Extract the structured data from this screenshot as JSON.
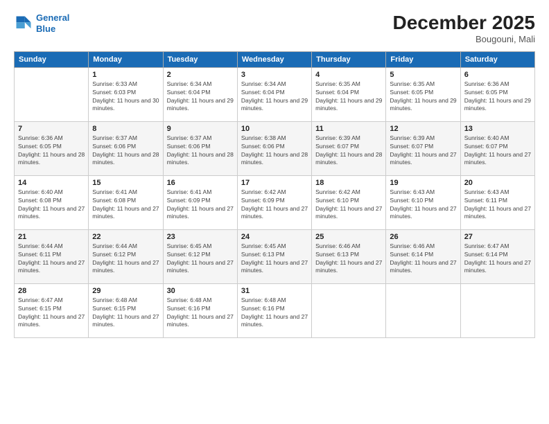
{
  "logo": {
    "line1": "General",
    "line2": "Blue"
  },
  "header": {
    "month": "December 2025",
    "location": "Bougouni, Mali"
  },
  "days_of_week": [
    "Sunday",
    "Monday",
    "Tuesday",
    "Wednesday",
    "Thursday",
    "Friday",
    "Saturday"
  ],
  "weeks": [
    [
      {
        "day": "",
        "sunrise": "",
        "sunset": "",
        "daylight": ""
      },
      {
        "day": "1",
        "sunrise": "Sunrise: 6:33 AM",
        "sunset": "Sunset: 6:03 PM",
        "daylight": "Daylight: 11 hours and 30 minutes."
      },
      {
        "day": "2",
        "sunrise": "Sunrise: 6:34 AM",
        "sunset": "Sunset: 6:04 PM",
        "daylight": "Daylight: 11 hours and 29 minutes."
      },
      {
        "day": "3",
        "sunrise": "Sunrise: 6:34 AM",
        "sunset": "Sunset: 6:04 PM",
        "daylight": "Daylight: 11 hours and 29 minutes."
      },
      {
        "day": "4",
        "sunrise": "Sunrise: 6:35 AM",
        "sunset": "Sunset: 6:04 PM",
        "daylight": "Daylight: 11 hours and 29 minutes."
      },
      {
        "day": "5",
        "sunrise": "Sunrise: 6:35 AM",
        "sunset": "Sunset: 6:05 PM",
        "daylight": "Daylight: 11 hours and 29 minutes."
      },
      {
        "day": "6",
        "sunrise": "Sunrise: 6:36 AM",
        "sunset": "Sunset: 6:05 PM",
        "daylight": "Daylight: 11 hours and 29 minutes."
      }
    ],
    [
      {
        "day": "7",
        "sunrise": "Sunrise: 6:36 AM",
        "sunset": "Sunset: 6:05 PM",
        "daylight": "Daylight: 11 hours and 28 minutes."
      },
      {
        "day": "8",
        "sunrise": "Sunrise: 6:37 AM",
        "sunset": "Sunset: 6:06 PM",
        "daylight": "Daylight: 11 hours and 28 minutes."
      },
      {
        "day": "9",
        "sunrise": "Sunrise: 6:37 AM",
        "sunset": "Sunset: 6:06 PM",
        "daylight": "Daylight: 11 hours and 28 minutes."
      },
      {
        "day": "10",
        "sunrise": "Sunrise: 6:38 AM",
        "sunset": "Sunset: 6:06 PM",
        "daylight": "Daylight: 11 hours and 28 minutes."
      },
      {
        "day": "11",
        "sunrise": "Sunrise: 6:39 AM",
        "sunset": "Sunset: 6:07 PM",
        "daylight": "Daylight: 11 hours and 28 minutes."
      },
      {
        "day": "12",
        "sunrise": "Sunrise: 6:39 AM",
        "sunset": "Sunset: 6:07 PM",
        "daylight": "Daylight: 11 hours and 27 minutes."
      },
      {
        "day": "13",
        "sunrise": "Sunrise: 6:40 AM",
        "sunset": "Sunset: 6:07 PM",
        "daylight": "Daylight: 11 hours and 27 minutes."
      }
    ],
    [
      {
        "day": "14",
        "sunrise": "Sunrise: 6:40 AM",
        "sunset": "Sunset: 6:08 PM",
        "daylight": "Daylight: 11 hours and 27 minutes."
      },
      {
        "day": "15",
        "sunrise": "Sunrise: 6:41 AM",
        "sunset": "Sunset: 6:08 PM",
        "daylight": "Daylight: 11 hours and 27 minutes."
      },
      {
        "day": "16",
        "sunrise": "Sunrise: 6:41 AM",
        "sunset": "Sunset: 6:09 PM",
        "daylight": "Daylight: 11 hours and 27 minutes."
      },
      {
        "day": "17",
        "sunrise": "Sunrise: 6:42 AM",
        "sunset": "Sunset: 6:09 PM",
        "daylight": "Daylight: 11 hours and 27 minutes."
      },
      {
        "day": "18",
        "sunrise": "Sunrise: 6:42 AM",
        "sunset": "Sunset: 6:10 PM",
        "daylight": "Daylight: 11 hours and 27 minutes."
      },
      {
        "day": "19",
        "sunrise": "Sunrise: 6:43 AM",
        "sunset": "Sunset: 6:10 PM",
        "daylight": "Daylight: 11 hours and 27 minutes."
      },
      {
        "day": "20",
        "sunrise": "Sunrise: 6:43 AM",
        "sunset": "Sunset: 6:11 PM",
        "daylight": "Daylight: 11 hours and 27 minutes."
      }
    ],
    [
      {
        "day": "21",
        "sunrise": "Sunrise: 6:44 AM",
        "sunset": "Sunset: 6:11 PM",
        "daylight": "Daylight: 11 hours and 27 minutes."
      },
      {
        "day": "22",
        "sunrise": "Sunrise: 6:44 AM",
        "sunset": "Sunset: 6:12 PM",
        "daylight": "Daylight: 11 hours and 27 minutes."
      },
      {
        "day": "23",
        "sunrise": "Sunrise: 6:45 AM",
        "sunset": "Sunset: 6:12 PM",
        "daylight": "Daylight: 11 hours and 27 minutes."
      },
      {
        "day": "24",
        "sunrise": "Sunrise: 6:45 AM",
        "sunset": "Sunset: 6:13 PM",
        "daylight": "Daylight: 11 hours and 27 minutes."
      },
      {
        "day": "25",
        "sunrise": "Sunrise: 6:46 AM",
        "sunset": "Sunset: 6:13 PM",
        "daylight": "Daylight: 11 hours and 27 minutes."
      },
      {
        "day": "26",
        "sunrise": "Sunrise: 6:46 AM",
        "sunset": "Sunset: 6:14 PM",
        "daylight": "Daylight: 11 hours and 27 minutes."
      },
      {
        "day": "27",
        "sunrise": "Sunrise: 6:47 AM",
        "sunset": "Sunset: 6:14 PM",
        "daylight": "Daylight: 11 hours and 27 minutes."
      }
    ],
    [
      {
        "day": "28",
        "sunrise": "Sunrise: 6:47 AM",
        "sunset": "Sunset: 6:15 PM",
        "daylight": "Daylight: 11 hours and 27 minutes."
      },
      {
        "day": "29",
        "sunrise": "Sunrise: 6:48 AM",
        "sunset": "Sunset: 6:15 PM",
        "daylight": "Daylight: 11 hours and 27 minutes."
      },
      {
        "day": "30",
        "sunrise": "Sunrise: 6:48 AM",
        "sunset": "Sunset: 6:16 PM",
        "daylight": "Daylight: 11 hours and 27 minutes."
      },
      {
        "day": "31",
        "sunrise": "Sunrise: 6:48 AM",
        "sunset": "Sunset: 6:16 PM",
        "daylight": "Daylight: 11 hours and 27 minutes."
      },
      {
        "day": "",
        "sunrise": "",
        "sunset": "",
        "daylight": ""
      },
      {
        "day": "",
        "sunrise": "",
        "sunset": "",
        "daylight": ""
      },
      {
        "day": "",
        "sunrise": "",
        "sunset": "",
        "daylight": ""
      }
    ]
  ]
}
